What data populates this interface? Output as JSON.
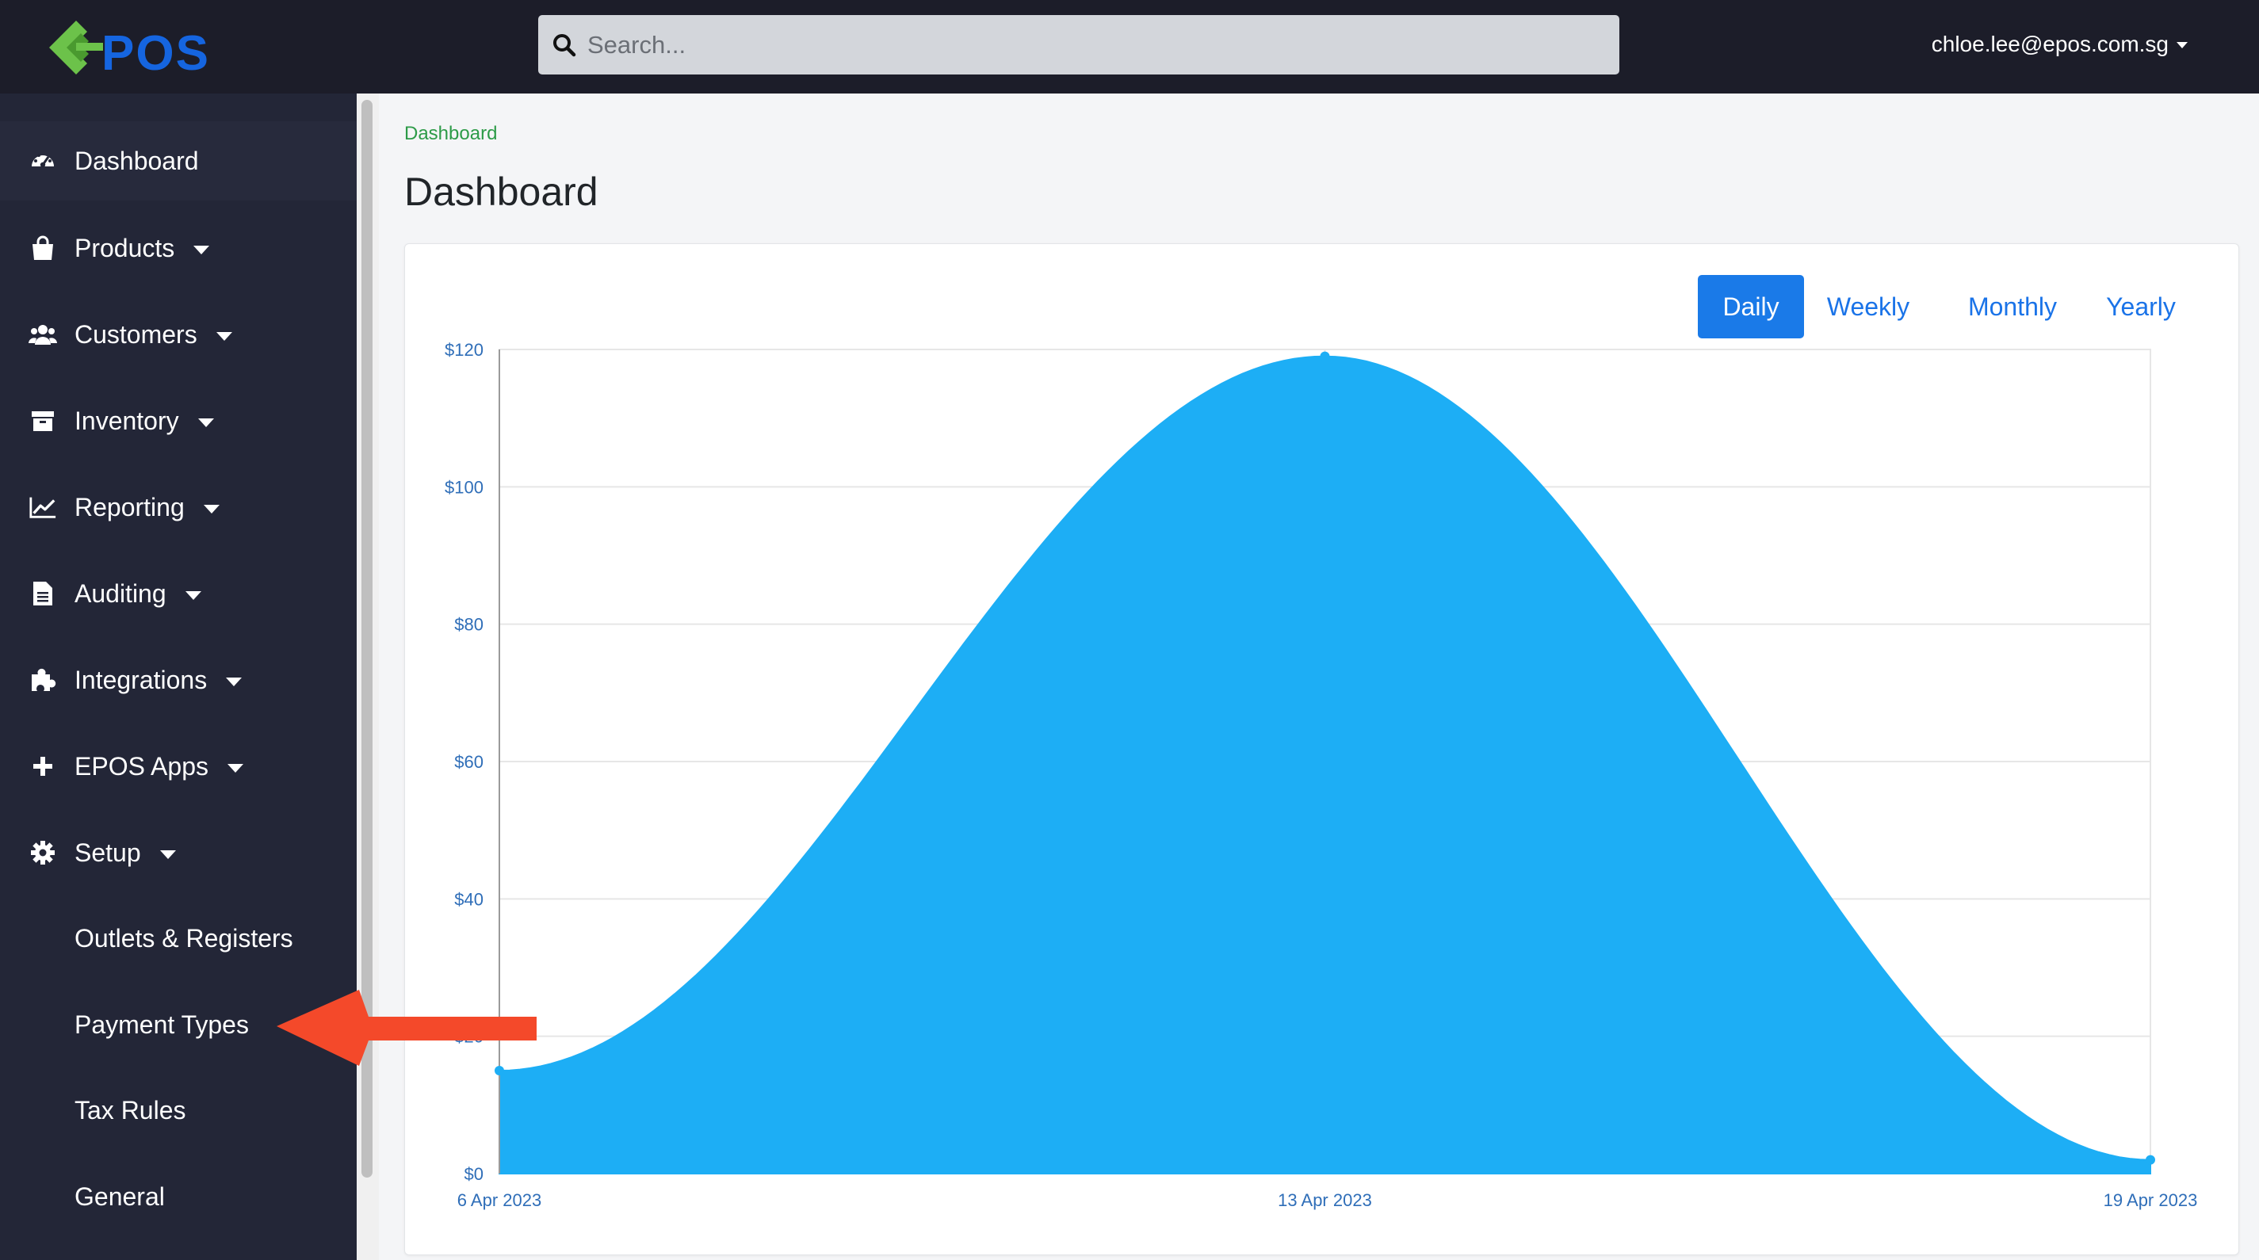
{
  "app": {
    "logo_text": "EPOS",
    "user_email": "chloe.lee@epos.com.sg"
  },
  "search": {
    "placeholder": "Search..."
  },
  "sidebar": {
    "items": [
      {
        "label": "Dashboard",
        "icon": "dashboard-icon",
        "caret": false
      },
      {
        "label": "Products",
        "icon": "shopping-bag-icon",
        "caret": true
      },
      {
        "label": "Customers",
        "icon": "users-icon",
        "caret": true
      },
      {
        "label": "Inventory",
        "icon": "archive-icon",
        "caret": true
      },
      {
        "label": "Reporting",
        "icon": "line-chart-icon",
        "caret": true
      },
      {
        "label": "Auditing",
        "icon": "document-icon",
        "caret": true
      },
      {
        "label": "Integrations",
        "icon": "puzzle-icon",
        "caret": true
      },
      {
        "label": "EPOS Apps",
        "icon": "plus-icon",
        "caret": true
      },
      {
        "label": "Setup",
        "icon": "gear-icon",
        "caret": true
      }
    ],
    "setup_sub_items": [
      "Outlets & Registers",
      "Payment Types",
      "Tax Rules",
      "General"
    ]
  },
  "main": {
    "breadcrumb": "Dashboard",
    "title": "Dashboard",
    "period_tabs": [
      "Daily",
      "Weekly",
      "Monthly",
      "Yearly"
    ],
    "active_tab": "Daily"
  },
  "annotation": {
    "arrow_points_to": "Payment Types",
    "arrow_color": "#f4492a"
  },
  "colors": {
    "topbar": "#1c1d29",
    "sidebar": "#232637",
    "accent": "#1a7ae8",
    "area_fill": "#1daef5",
    "breadcrumb": "#2d9b48"
  },
  "chart_data": {
    "type": "area",
    "x": [
      "6 Apr 2023",
      "13 Apr 2023",
      "19 Apr 2023"
    ],
    "series": [
      {
        "values": [
          15,
          119,
          2
        ]
      }
    ],
    "ylim": [
      0,
      120
    ],
    "yticks": [
      0,
      20,
      40,
      60,
      80,
      100,
      120
    ],
    "ytick_labels": [
      "$0",
      "$20",
      "$40",
      "$60",
      "$80",
      "$100",
      "$120"
    ],
    "grid": true,
    "smooth": true,
    "title": "",
    "xlabel": "",
    "ylabel": ""
  }
}
